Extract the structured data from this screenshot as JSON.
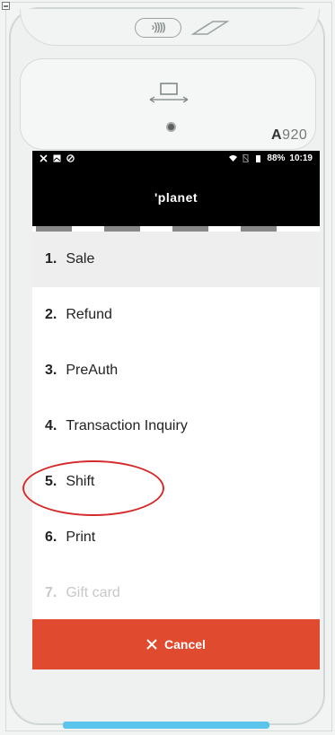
{
  "device": {
    "model_prefix": "A",
    "model_number": "920",
    "nfc_symbol": "›))))"
  },
  "status_bar": {
    "battery": "88%",
    "time": "10:19"
  },
  "header": {
    "brand": "'planet"
  },
  "menu": {
    "items": [
      {
        "num": "1.",
        "label": "Sale",
        "selected": true
      },
      {
        "num": "2.",
        "label": "Refund"
      },
      {
        "num": "3.",
        "label": "PreAuth"
      },
      {
        "num": "4.",
        "label": "Transaction Inquiry"
      },
      {
        "num": "5.",
        "label": "Shift",
        "circled": true
      },
      {
        "num": "6.",
        "label": "Print"
      },
      {
        "num": "7.",
        "label": "Gift card",
        "disabled": true
      }
    ]
  },
  "cancel": {
    "label": "Cancel",
    "icon": "close-icon"
  },
  "colors": {
    "cancel_bg": "#e04a2f",
    "annotation": "#d62a2a",
    "accent_bar": "#5bc4ea"
  }
}
